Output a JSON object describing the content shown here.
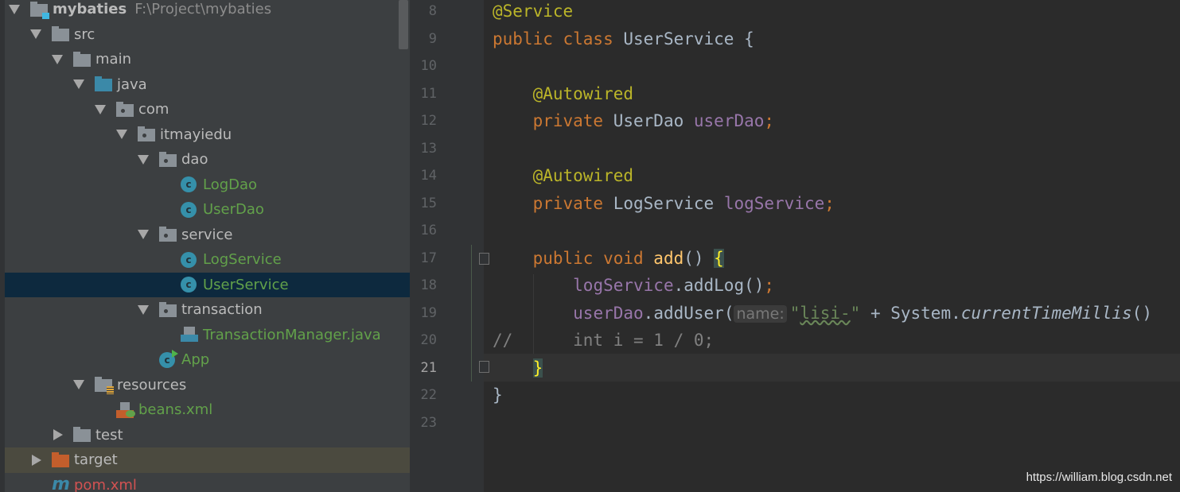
{
  "project_tree": {
    "root": {
      "name": "mybaties",
      "path": "F:\\Project\\mybaties"
    },
    "items": [
      {
        "label": "src",
        "level": 1,
        "icon": "folder-icon",
        "expanded": true
      },
      {
        "label": "main",
        "level": 2,
        "icon": "folder-icon",
        "expanded": true
      },
      {
        "label": "java",
        "level": 3,
        "icon": "source-folder-icon",
        "expanded": true
      },
      {
        "label": "com",
        "level": 4,
        "icon": "package-icon",
        "expanded": true
      },
      {
        "label": "itmayiedu",
        "level": 5,
        "icon": "package-icon",
        "expanded": true
      },
      {
        "label": "dao",
        "level": 6,
        "icon": "package-icon",
        "expanded": true
      },
      {
        "label": "LogDao",
        "level": 7,
        "icon": "class-icon"
      },
      {
        "label": "UserDao",
        "level": 7,
        "icon": "class-icon"
      },
      {
        "label": "service",
        "level": 6,
        "icon": "package-icon",
        "expanded": true
      },
      {
        "label": "LogService",
        "level": 7,
        "icon": "class-icon"
      },
      {
        "label": "UserService",
        "level": 7,
        "icon": "class-icon",
        "selected": true
      },
      {
        "label": "transaction",
        "level": 6,
        "icon": "package-icon",
        "expanded": true
      },
      {
        "label": "TransactionManager.java",
        "level": 7,
        "icon": "java-file-icon"
      },
      {
        "label": "App",
        "level": 6,
        "icon": "runnable-class-icon"
      },
      {
        "label": "resources",
        "level": 3,
        "icon": "resources-folder-icon",
        "expanded": true
      },
      {
        "label": "beans.xml",
        "level": 4,
        "icon": "spring-xml-icon"
      },
      {
        "label": "test",
        "level": 2,
        "icon": "folder-icon",
        "expanded": false
      },
      {
        "label": "target",
        "level": 1,
        "icon": "excluded-folder-icon",
        "expanded": false,
        "highlighted": true
      },
      {
        "label": "pom.xml",
        "level": 1,
        "icon": "maven-icon"
      }
    ]
  },
  "editor": {
    "current_line": 21,
    "lines": [
      {
        "n": "8",
        "t": [
          [
            "ann",
            "@Service"
          ]
        ]
      },
      {
        "n": "9",
        "t": [
          [
            "kw",
            "public class "
          ],
          [
            "",
            "UserService {"
          ]
        ]
      },
      {
        "n": "10",
        "t": []
      },
      {
        "n": "11",
        "t": [
          [
            "",
            "    "
          ],
          [
            "ann",
            "@Autowired"
          ]
        ]
      },
      {
        "n": "12",
        "t": [
          [
            "",
            "    "
          ],
          [
            "kw",
            "private "
          ],
          [
            "",
            "UserDao "
          ],
          [
            "fld",
            "userDao"
          ],
          [
            "kw",
            ";"
          ]
        ]
      },
      {
        "n": "13",
        "t": []
      },
      {
        "n": "14",
        "t": [
          [
            "",
            "    "
          ],
          [
            "ann",
            "@Autowired"
          ]
        ]
      },
      {
        "n": "15",
        "t": [
          [
            "",
            "    "
          ],
          [
            "kw",
            "private "
          ],
          [
            "",
            "LogService "
          ],
          [
            "fld",
            "logService"
          ],
          [
            "kw",
            ";"
          ]
        ]
      },
      {
        "n": "16",
        "t": []
      },
      {
        "n": "17",
        "t": [
          [
            "",
            "    "
          ],
          [
            "kw",
            "public void "
          ],
          [
            "fn",
            "add"
          ],
          [
            "",
            "() "
          ],
          [
            "brace",
            "{"
          ]
        ]
      },
      {
        "n": "18",
        "t": [
          [
            "",
            "        "
          ],
          [
            "fld",
            "logService"
          ],
          [
            "",
            ".addLog()"
          ],
          [
            "kw",
            ";"
          ]
        ]
      },
      {
        "n": "19",
        "t": [
          [
            "",
            "        "
          ],
          [
            "fld",
            "userDao"
          ],
          [
            "",
            ".addUser("
          ],
          [
            "hint",
            "name:"
          ],
          [
            "str",
            "\""
          ],
          [
            "str wavy",
            "lisi-"
          ],
          [
            "str",
            "\""
          ],
          [
            "",
            " + System."
          ],
          [
            "it",
            "currentTimeMillis"
          ],
          [
            "",
            "()"
          ]
        ]
      },
      {
        "n": "20",
        "t": [
          [
            "cm",
            "//      int i = 1 / 0;"
          ]
        ]
      },
      {
        "n": "21",
        "t": [
          [
            "",
            "    "
          ],
          [
            "brace",
            "}"
          ]
        ]
      },
      {
        "n": "22",
        "t": [
          [
            "",
            "}"
          ]
        ]
      },
      {
        "n": "23",
        "t": []
      }
    ]
  },
  "watermark": "https://william.blog.csdn.net"
}
